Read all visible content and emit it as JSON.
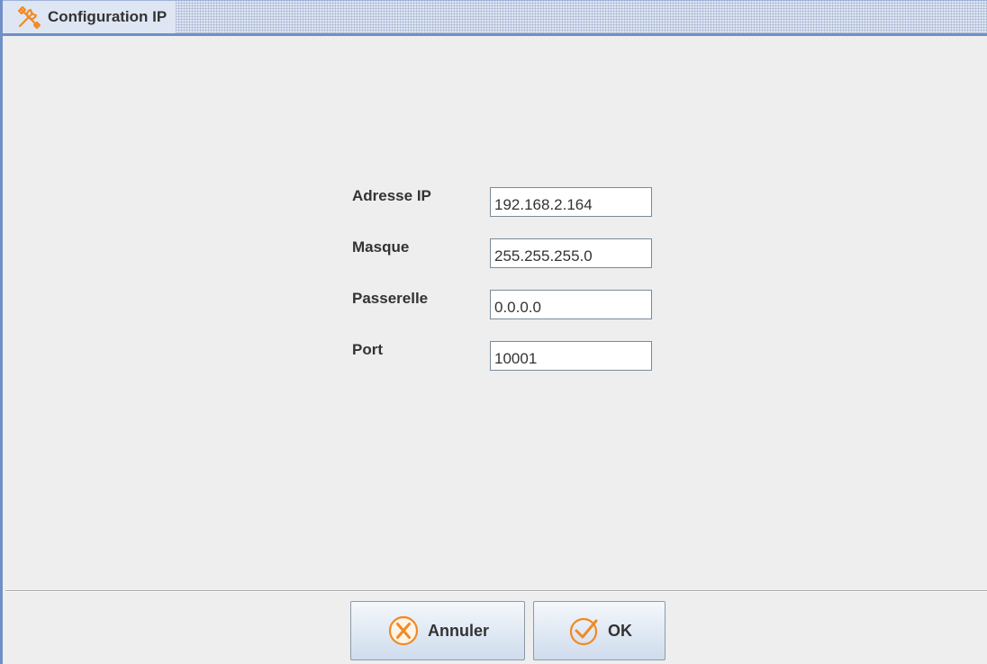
{
  "window": {
    "title": "Configuration IP",
    "icon": "tools-icon"
  },
  "form": {
    "fields": [
      {
        "label": "Adresse IP",
        "value": "192.168.2.164"
      },
      {
        "label": "Masque",
        "value": "255.255.255.0"
      },
      {
        "label": "Passerelle",
        "value": "0.0.0.0"
      },
      {
        "label": "Port",
        "value": "10001"
      }
    ]
  },
  "buttons": {
    "cancel": {
      "label": "Annuler",
      "icon": "cancel-x-icon"
    },
    "ok": {
      "label": "OK",
      "icon": "check-icon"
    }
  },
  "colors": {
    "accent": "#f08a24",
    "background": "#eeeeee",
    "titlebar_border": "#6f8fc6"
  }
}
